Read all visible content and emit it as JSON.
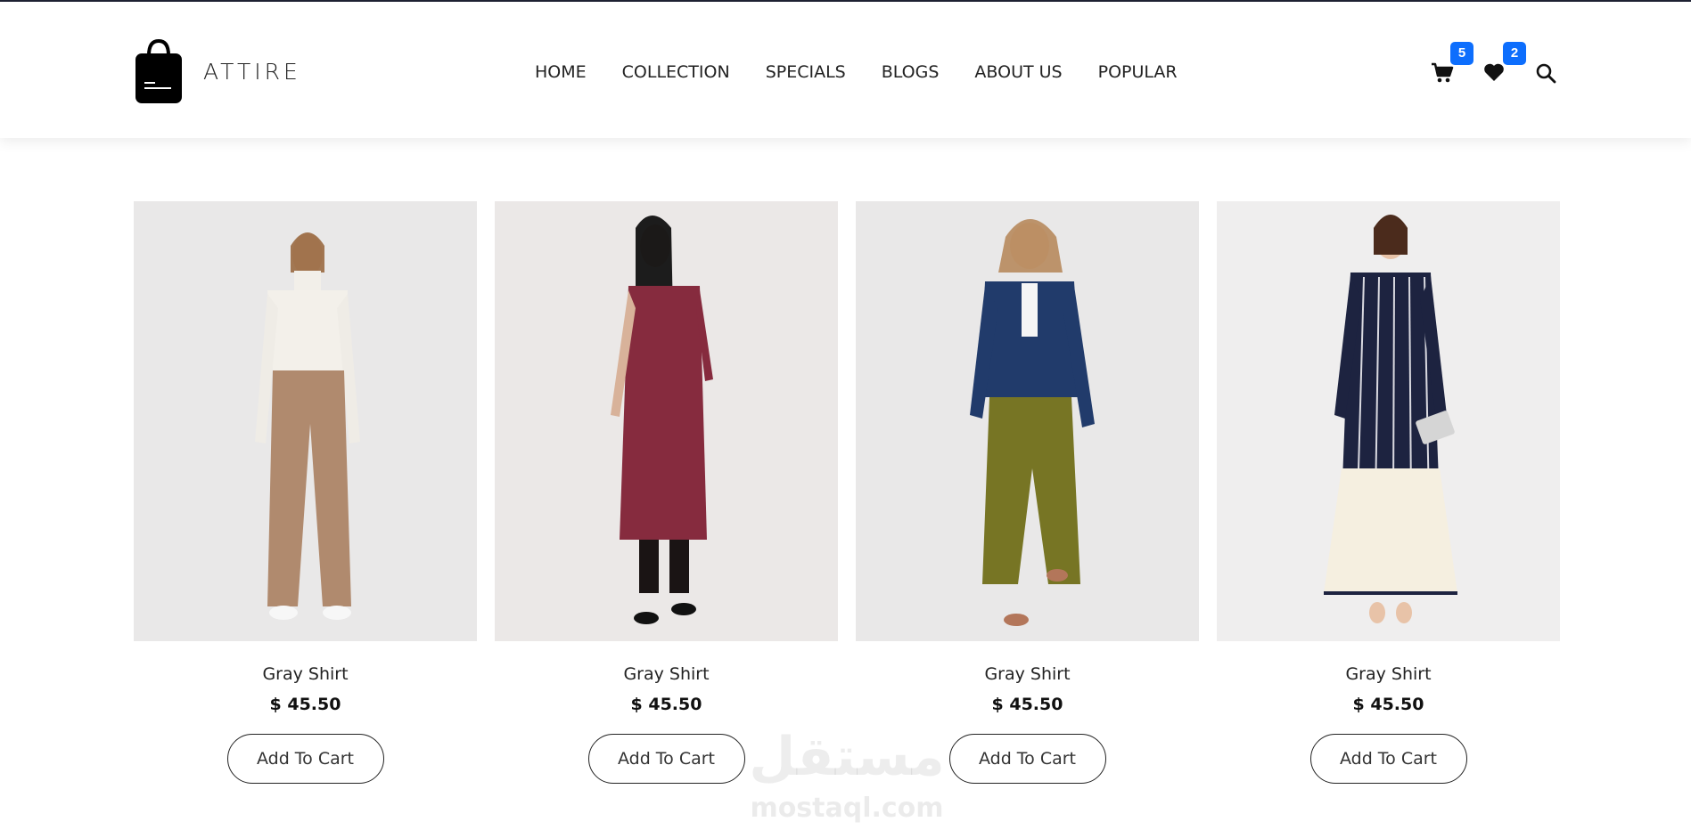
{
  "brand": {
    "name": "ATTIRE",
    "logo_icon": "shopping-bag-icon"
  },
  "nav": {
    "items": [
      "HOME",
      "COLLECTION",
      "SPECIALS",
      "BLOGS",
      "ABOUT US",
      "POPULAR"
    ]
  },
  "header_icons": {
    "cart": {
      "icon": "cart-icon",
      "count": "5"
    },
    "wishlist": {
      "icon": "heart-icon",
      "count": "2"
    },
    "search": {
      "icon": "search-icon"
    }
  },
  "products": [
    {
      "name": "Gray Shirt",
      "price": "$ 45.50",
      "button": "Add To Cart"
    },
    {
      "name": "Gray Shirt",
      "price": "$ 45.50",
      "button": "Add To Cart"
    },
    {
      "name": "Gray Shirt",
      "price": "$ 45.50",
      "button": "Add To Cart"
    },
    {
      "name": "Gray Shirt",
      "price": "$ 45.50",
      "button": "Add To Cart"
    }
  ],
  "watermark": {
    "text_ar": "مستقل",
    "text_en": "mostaql.com"
  },
  "colors": {
    "accent": "#0d6efd",
    "dark": "#1f2233"
  }
}
